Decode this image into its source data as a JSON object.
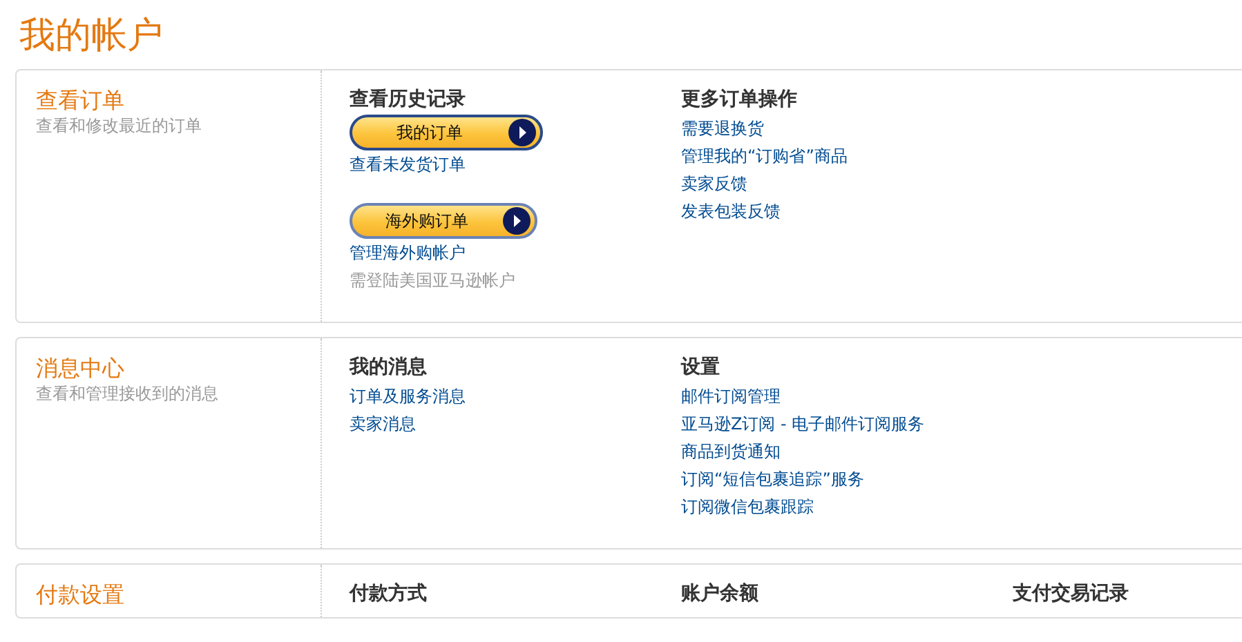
{
  "page_title": "我的帐户",
  "sections": [
    {
      "title": "查看订单",
      "description": "查看和修改最近的订单",
      "columns": [
        {
          "heading": "查看历史记录",
          "items": [
            {
              "kind": "button",
              "text": "我的订单"
            },
            {
              "kind": "link",
              "text": "查看未发货订单"
            },
            {
              "kind": "button",
              "text": "海外购订单"
            },
            {
              "kind": "link",
              "text": "管理海外购帐户"
            },
            {
              "kind": "note",
              "text": "需登陆美国亚马逊帐户"
            }
          ]
        },
        {
          "heading": "更多订单操作",
          "items": [
            {
              "kind": "link",
              "text": "需要退换货"
            },
            {
              "kind": "link",
              "text": "管理我的“订购省”商品"
            },
            {
              "kind": "link",
              "text": "卖家反馈"
            },
            {
              "kind": "link",
              "text": "发表包装反馈"
            }
          ]
        }
      ]
    },
    {
      "title": "消息中心",
      "description": "查看和管理接收到的消息",
      "columns": [
        {
          "heading": "我的消息",
          "items": [
            {
              "kind": "link",
              "text": "订单及服务消息"
            },
            {
              "kind": "link",
              "text": "卖家消息"
            }
          ]
        },
        {
          "heading": "设置",
          "items": [
            {
              "kind": "link",
              "text": "邮件订阅管理"
            },
            {
              "kind": "link",
              "text": "亚马逊Z订阅 - 电子邮件订阅服务"
            },
            {
              "kind": "link",
              "text": "商品到货通知"
            },
            {
              "kind": "link",
              "text": "订阅“短信包裹追踪”服务"
            },
            {
              "kind": "link",
              "text": "订阅微信包裹跟踪"
            }
          ]
        }
      ]
    },
    {
      "title": "付款设置",
      "columns": [
        {
          "heading": "付款方式"
        },
        {
          "heading": "账户余额"
        },
        {
          "heading": "支付交易记录"
        }
      ]
    }
  ]
}
